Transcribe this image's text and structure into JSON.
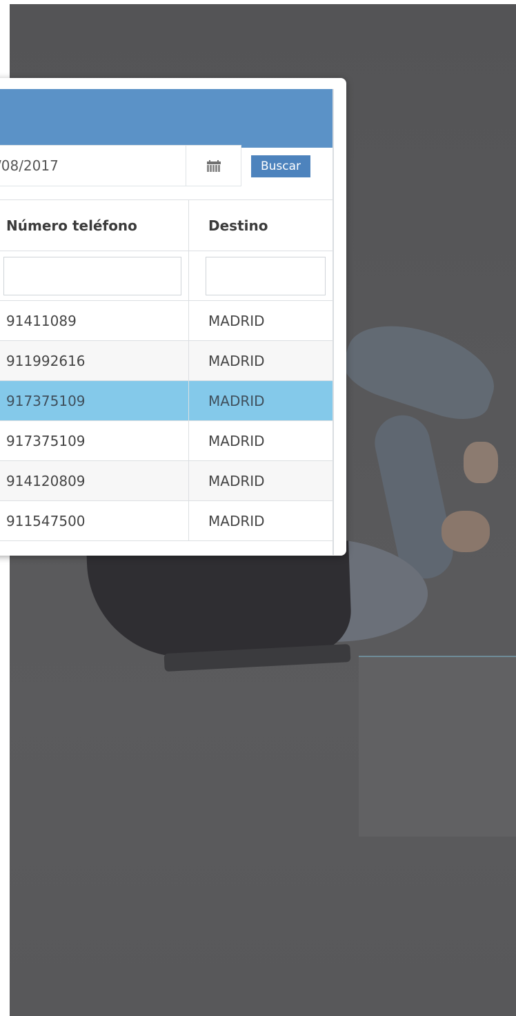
{
  "search": {
    "date_value": "/08/2017",
    "button_label": "Buscar"
  },
  "table": {
    "columns": [
      "Número teléfono",
      "Destino"
    ],
    "rows": [
      {
        "phone": "91411089",
        "destination": "MADRID"
      },
      {
        "phone": "911992616",
        "destination": "MADRID"
      },
      {
        "phone": "917375109",
        "destination": "MADRID",
        "selected": true
      },
      {
        "phone": "917375109",
        "destination": "MADRID"
      },
      {
        "phone": "914120809",
        "destination": "MADRID"
      },
      {
        "phone": "911547500",
        "destination": "MADRID"
      }
    ]
  },
  "colors": {
    "header": "#5b92c7",
    "button": "#4d83bd",
    "selected_row": "#84c9ea",
    "overlay": "#58585a"
  },
  "icons": {
    "calendar": "calendar-icon"
  }
}
